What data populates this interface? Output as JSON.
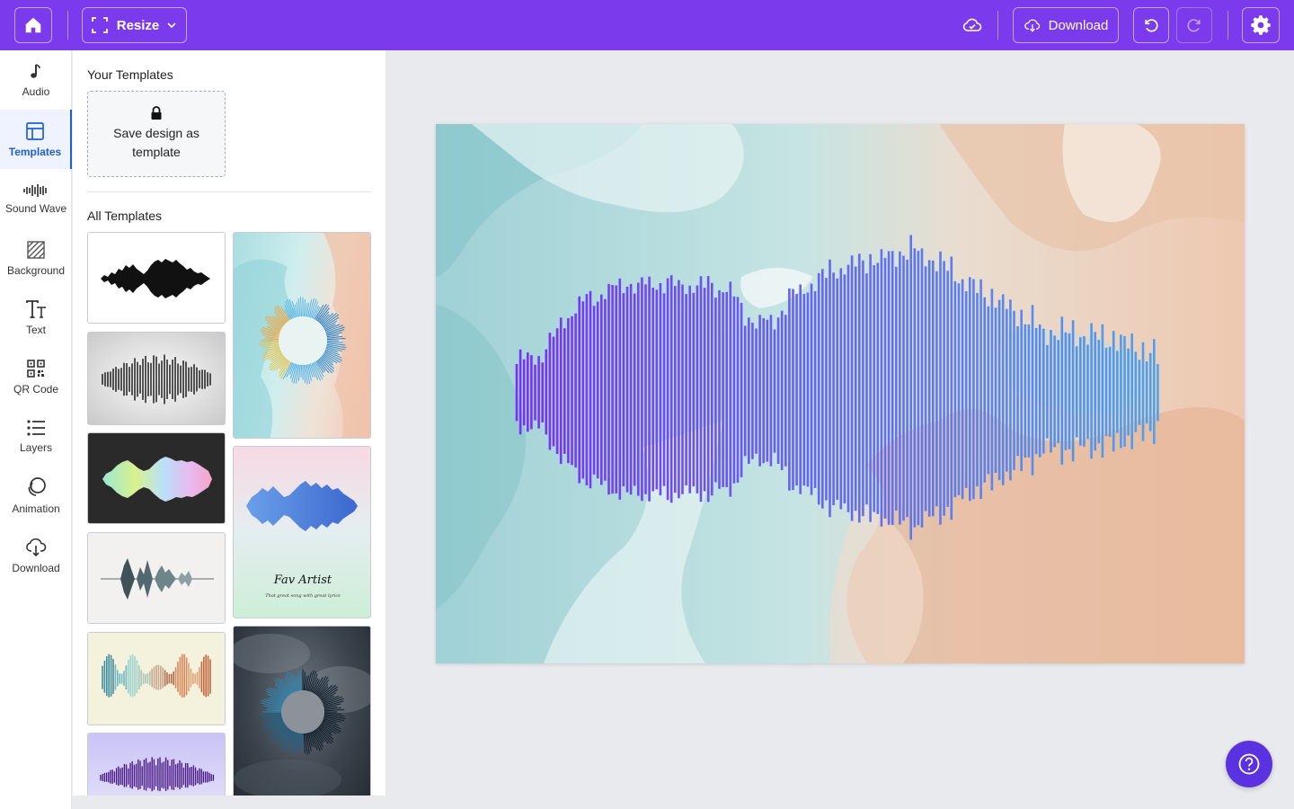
{
  "topbar": {
    "home_icon": "home-icon",
    "resize_label": "Resize",
    "download_label": "Download",
    "cloud_icon": "cloud-sync-icon",
    "undo_icon": "undo-icon",
    "redo_icon": "redo-icon",
    "settings_icon": "gear-icon"
  },
  "leftnav": {
    "items": [
      {
        "label": "Audio",
        "icon": "music-note-icon"
      },
      {
        "label": "Templates",
        "icon": "templates-icon",
        "active": true
      },
      {
        "label": "Sound Wave",
        "icon": "sound-wave-icon"
      },
      {
        "label": "Background",
        "icon": "background-icon"
      },
      {
        "label": "Text",
        "icon": "text-icon"
      },
      {
        "label": "QR Code",
        "icon": "qr-code-icon"
      },
      {
        "label": "Layers",
        "icon": "layers-icon"
      },
      {
        "label": "Animation",
        "icon": "animation-icon"
      },
      {
        "label": "Download",
        "icon": "download-cloud-icon"
      }
    ]
  },
  "panel": {
    "your_templates_title": "Your Templates",
    "save_template_label": "Save design as template",
    "all_templates_title": "All Templates",
    "template_card_text": {
      "title": "Fav Artist",
      "subtitle": "That great song with great lyrics"
    }
  },
  "colors": {
    "topbar": "#7c3aed",
    "active_nav": "#1f5fd6",
    "help_button": "#5b32e0",
    "wave_start": "#7b2ff7",
    "wave_end": "#4aa3f0"
  },
  "help_icon": "help-circle-icon"
}
